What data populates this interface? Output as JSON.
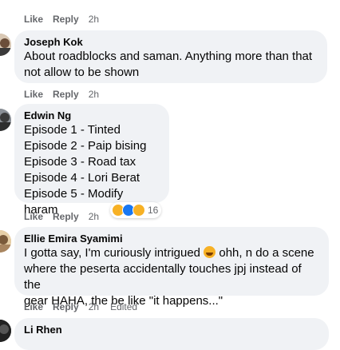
{
  "comments": [
    {
      "author": "",
      "lines": [],
      "actions": {
        "like": "Like",
        "reply": "Reply",
        "time": "2h"
      }
    },
    {
      "author": "Joseph Kok",
      "lines": [
        "About roadblocks and saman. Anything more than that",
        "not allow to be shown"
      ],
      "actions": {
        "like": "Like",
        "reply": "Reply",
        "time": "2h"
      }
    },
    {
      "author": "Edwin Ng",
      "lines": [
        "Episode 1 - Tinted",
        "Episode 2 - Paip bising",
        "Episode 3 - Road tax",
        "Episode 4 - Lori Berat",
        "Episode 5 - Modify haram"
      ],
      "actions": {
        "like": "Like",
        "reply": "Reply",
        "time": "2h"
      },
      "reactions": {
        "count": "16",
        "icons": [
          "haha-icon",
          "like-icon",
          "care-icon"
        ]
      }
    },
    {
      "author": "Ellie Emira Syamimi",
      "line1_a": "I gotta say, I'm curiously intrigued ",
      "line1_b": " ohh, n do a scene",
      "line2": "where the peserta accidentally touches jpj instead of the",
      "line3": "gear HAHA, the be like \"it happens...\"",
      "actions": {
        "like": "Like",
        "reply": "Reply",
        "time": "2h",
        "edited": "Edited"
      }
    },
    {
      "author": "Li Rhen",
      "lines": []
    }
  ],
  "colors": {
    "bubble": "#f0f2f5",
    "meta": "#65676b",
    "text": "#050505",
    "like": "#1877f2",
    "haha": "#f7b125"
  }
}
